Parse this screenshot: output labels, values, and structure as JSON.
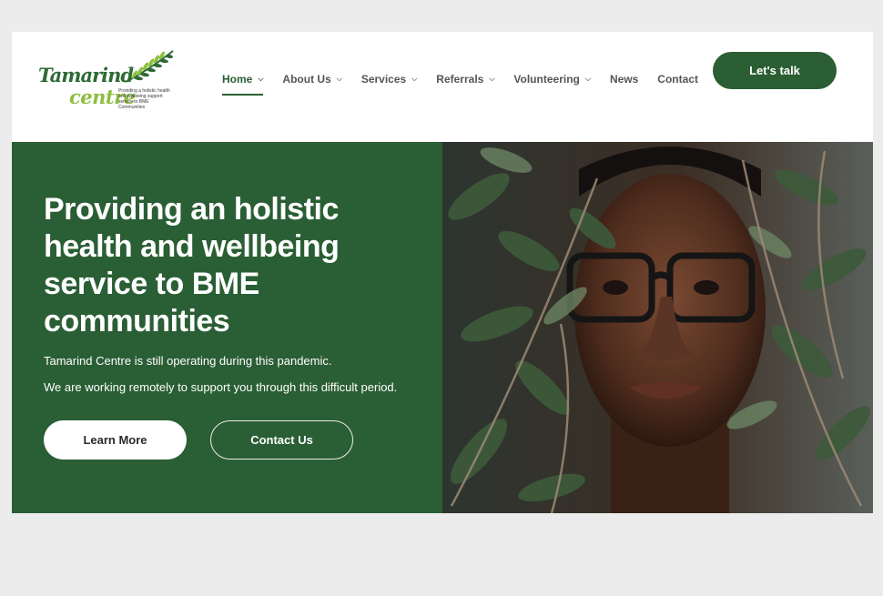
{
  "logo": {
    "word1": "Tamarind",
    "word2": "centre",
    "tagline": "Providing a holistic health and wellbeing support service to BME Communities"
  },
  "nav": {
    "items": [
      {
        "label": "Home",
        "dropdown": true,
        "active": true
      },
      {
        "label": "About Us",
        "dropdown": true
      },
      {
        "label": "Services",
        "dropdown": true
      },
      {
        "label": "Referrals",
        "dropdown": true
      },
      {
        "label": "Volunteering",
        "dropdown": true
      },
      {
        "label": "News",
        "dropdown": false
      },
      {
        "label": "Contact",
        "dropdown": false
      }
    ],
    "cta_label": "Let's talk"
  },
  "hero": {
    "title": "Providing an holistic health and wellbeing service to BME communities",
    "text1": "Tamarind Centre is still operating during this pandemic.",
    "text2": "We are working remotely to support you through this difficult period.",
    "learn_more_label": "Learn More",
    "contact_label": "Contact Us"
  },
  "colors": {
    "brand_green": "#2a5e34",
    "logo_light_green": "#8dbf3f",
    "page_bg": "#ececec"
  }
}
